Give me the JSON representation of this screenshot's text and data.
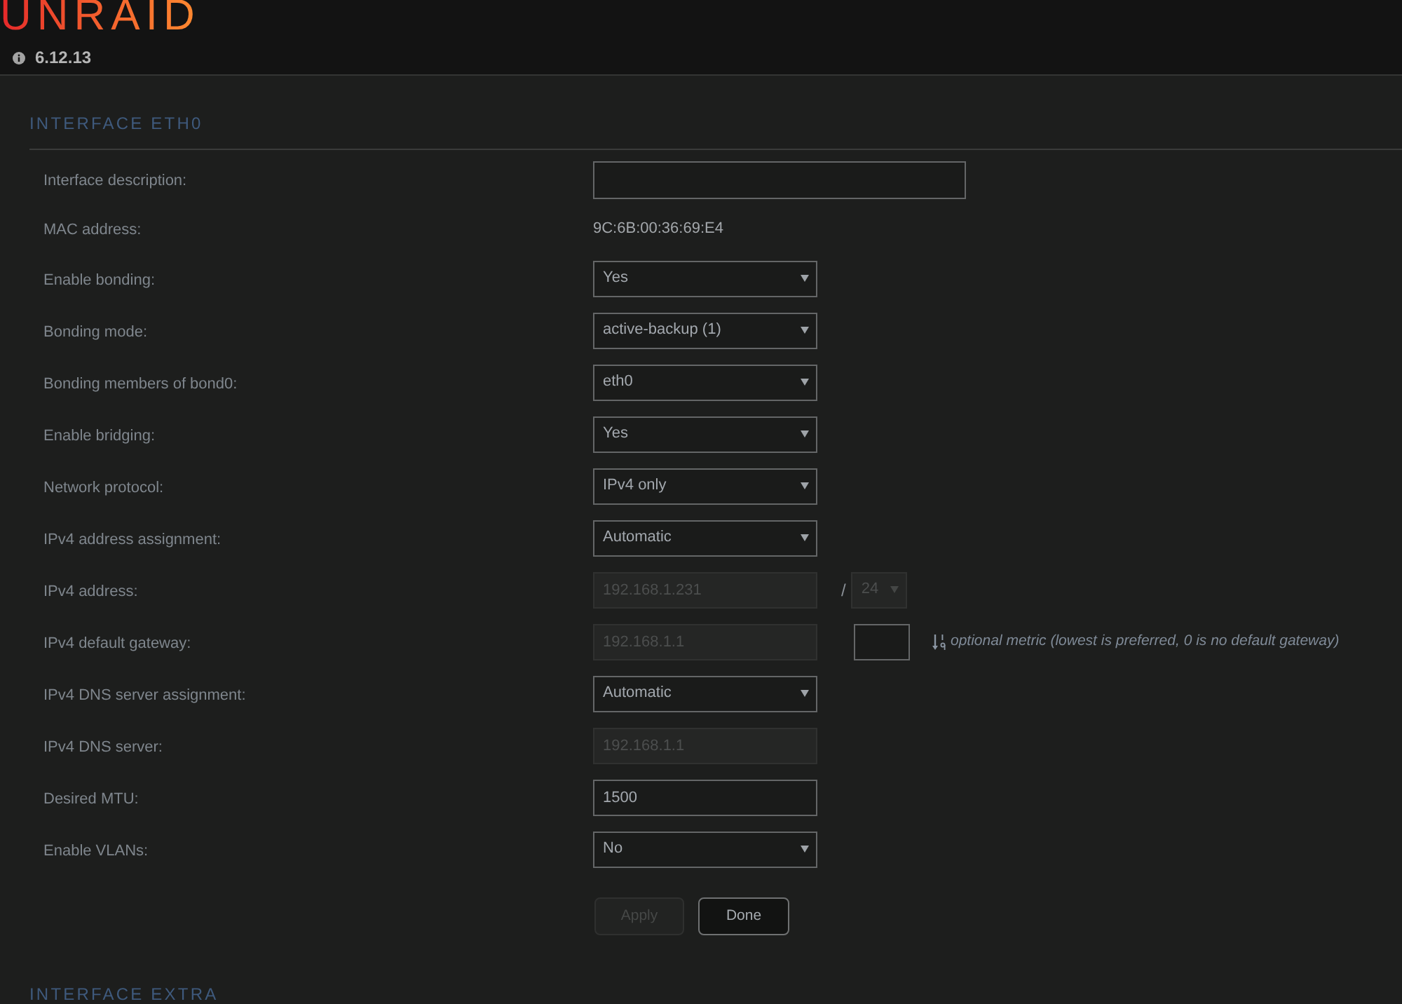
{
  "header": {
    "logo": "UNRAID",
    "version": "6.12.13"
  },
  "sections": [
    {
      "title": "INTERFACE ETH0",
      "rows": [
        {
          "label": "Interface description:",
          "controls": [
            {
              "kind": "textbox",
              "disabled": false
            }
          ]
        },
        {
          "label": "MAC address:",
          "controls": [
            {
              "kind": "value",
              "text": "9C:6B:00:36:69:E4"
            }
          ]
        },
        {
          "label": "Enable bonding:",
          "controls": [
            {
              "kind": "select",
              "value": "Yes",
              "disabled": false
            }
          ]
        },
        {
          "label": "Bonding mode:",
          "controls": [
            {
              "kind": "select",
              "value": "active-backup (1)",
              "disabled": false
            }
          ]
        },
        {
          "label": "Bonding members of bond0:",
          "controls": [
            {
              "kind": "select",
              "value": "eth0",
              "disabled": false
            }
          ]
        },
        {
          "label": "Enable bridging:",
          "controls": [
            {
              "kind": "select",
              "value": "Yes",
              "disabled": false
            }
          ]
        },
        {
          "label": "Network protocol:",
          "controls": [
            {
              "kind": "select",
              "value": "IPv4 only",
              "disabled": false
            }
          ]
        },
        {
          "label": "IPv4 address assignment:",
          "controls": [
            {
              "kind": "select",
              "value": "Automatic",
              "disabled": false
            }
          ]
        },
        {
          "label": "IPv4 address:",
          "controls": [
            {
              "kind": "input",
              "value": "192.168.1.231",
              "disabled": true
            },
            {
              "kind": "separator",
              "text": "/"
            },
            {
              "kind": "netmask",
              "value": "24",
              "disabled": true
            }
          ]
        },
        {
          "label": "IPv4 default gateway:",
          "controls": [
            {
              "kind": "input",
              "value": "192.168.1.1",
              "disabled": true
            },
            {
              "kind": "metric",
              "disabled": false
            },
            {
              "kind": "hint",
              "text": "optional metric (lowest is preferred, 0 is no default gateway)"
            }
          ]
        },
        {
          "label": "IPv4 DNS server assignment:",
          "controls": [
            {
              "kind": "select",
              "value": "Automatic",
              "disabled": false
            }
          ]
        },
        {
          "label": "IPv4 DNS server:",
          "controls": [
            {
              "kind": "input",
              "value": "192.168.1.1",
              "disabled": true
            }
          ]
        },
        {
          "label": "Desired MTU:",
          "controls": [
            {
              "kind": "input",
              "value": "1500",
              "disabled": false
            }
          ]
        },
        {
          "label": "Enable VLANs:",
          "controls": [
            {
              "kind": "select",
              "value": "No",
              "disabled": false
            }
          ]
        }
      ],
      "buttons": [
        {
          "label": "Apply",
          "disabled": true
        },
        {
          "label": "Done",
          "disabled": false
        }
      ]
    },
    {
      "title": "INTERFACE EXTRA"
    }
  ]
}
